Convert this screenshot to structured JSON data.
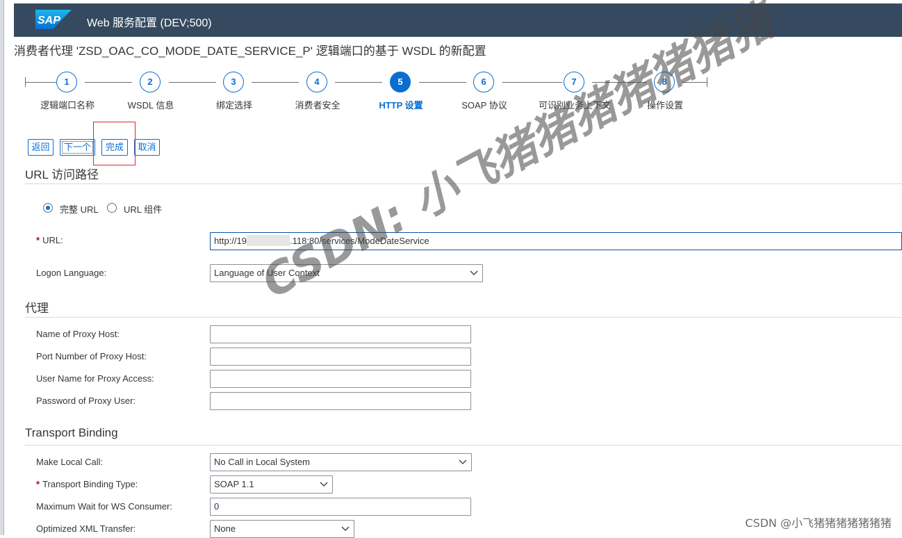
{
  "shell": {
    "logo_text": "SAP",
    "title": "Web 服务配置 (DEV;500)"
  },
  "page_title": "消费者代理 'ZSD_OAC_CO_MODE_DATE_SERVICE_P' 逻辑端口的基于 WSDL 的新配置",
  "stepper": {
    "steps": [
      {
        "number": "1",
        "label": "逻辑端口名称"
      },
      {
        "number": "2",
        "label": "WSDL 信息"
      },
      {
        "number": "3",
        "label": "绑定选择"
      },
      {
        "number": "4",
        "label": "消费者安全"
      },
      {
        "number": "5",
        "label": "HTTP 设置"
      },
      {
        "number": "6",
        "label": "SOAP 协议"
      },
      {
        "number": "7",
        "label": "可识别业务上下文"
      },
      {
        "number": "8",
        "label": "操作设置"
      }
    ],
    "active_step": 5
  },
  "toolbar": {
    "back": "返回",
    "next": "下一个",
    "finish": "完成",
    "cancel": "取消"
  },
  "url_section": {
    "title": "URL 访问路径",
    "radio_full": "完整 URL",
    "radio_components": "URL 组件",
    "url_label": "URL:",
    "url_prefix": "http://19",
    "url_suffix": ".118:80/services/ModeDateService",
    "logon_language_label": "Logon Language:",
    "logon_language_value": "Language of User Context"
  },
  "proxy_section": {
    "title": "代理",
    "host_label": "Name of Proxy Host:",
    "port_label": "Port Number of Proxy Host:",
    "user_label": "User Name for Proxy Access:",
    "password_label": "Password of Proxy User:"
  },
  "transport_section": {
    "title": "Transport Binding",
    "local_call_label": "Make Local Call:",
    "local_call_value": "No Call in Local System",
    "binding_type_label": "Transport Binding Type:",
    "binding_type_value": "SOAP 1.1",
    "max_wait_label": "Maximum Wait for WS Consumer:",
    "max_wait_value": "0",
    "xml_transfer_label": "Optimized XML Transfer:",
    "xml_transfer_value": "None"
  },
  "watermark": "CSDN: 小飞猪猪猪猪猪猪猪",
  "credit": "CSDN @小飞猪猪猪猪猪猪猪",
  "colors": {
    "shell_bg": "#354a5f",
    "accent": "#0a6ed1",
    "highlight_box": "#d9272e",
    "required": "#bb0000"
  }
}
